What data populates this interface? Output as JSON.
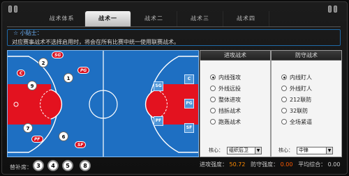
{
  "tabs": [
    "战术体系",
    "战术一",
    "战术二",
    "战术三",
    "战术四"
  ],
  "active_tab_index": 1,
  "tip": {
    "title": "☆ 小贴士：",
    "text": "对应赛事战术不选择启用时，将会在所有比赛中统一使用联赛战术。"
  },
  "court": {
    "players": [
      {
        "number": "2"
      },
      {
        "number": "1"
      },
      {
        "number": "9"
      },
      {
        "number": "7"
      },
      {
        "number": "6"
      }
    ],
    "opponent_labels": [
      "SG",
      "PG",
      "C",
      "PF",
      "SF"
    ],
    "home_positions": [
      "SG",
      "C",
      "PG",
      "PF",
      "SF"
    ]
  },
  "offense": {
    "header": "进攻战术",
    "options": [
      "内线强攻",
      "外线远投",
      "整体进攻",
      "挡拆战术",
      "跑轰战术"
    ],
    "selected": 0,
    "core_label": "核心：",
    "core_value": "组织后卫"
  },
  "defense": {
    "header": "防守战术",
    "options": [
      "内线盯人",
      "外线盯人",
      "212联防",
      "32联防",
      "全场紧逼"
    ],
    "selected": 0,
    "core_label": "核心：",
    "core_value": "中锋"
  },
  "bench": {
    "label": "替补席：",
    "numbers": [
      "3",
      "4",
      "5",
      "8"
    ]
  },
  "stats": {
    "offense_label": "进攻强度：",
    "offense_value": "50.72",
    "defense_label": "防守强度：",
    "defense_value": "0.00",
    "avg_label": "平均综合：",
    "avg_value": "0.00"
  },
  "colors": {
    "court_blue": "#1e6fc2",
    "paint_red": "#e3121f",
    "tip_blue": "#6fb6ff"
  }
}
